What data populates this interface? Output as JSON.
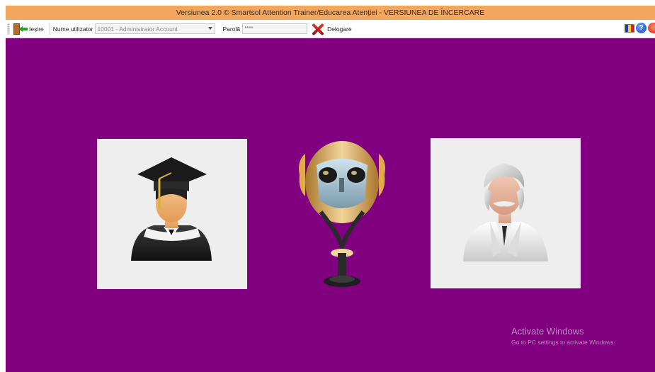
{
  "window": {
    "title": "Versiunea 2.0 © Smartsol Attention Trainer/Educarea Atenției - VERSIUNEA DE ÎNCERCARE"
  },
  "toolbar": {
    "exit_label": "Ieșire",
    "username_label": "Nume utilizator",
    "username_value": "10001 - Administrator Account",
    "password_label": "Parolă",
    "password_value": "****",
    "logout_label": "Delogare",
    "flag_colors": [
      "#1b3fa8",
      "#f6d11b",
      "#d11e2a"
    ],
    "help_glyph": "?"
  },
  "main": {
    "background": "#800080",
    "cards": [
      {
        "name": "student",
        "icon": "graduate-icon"
      },
      {
        "name": "viewer",
        "icon": "binocular-viewer-icon"
      },
      {
        "name": "doctor",
        "icon": "doctor-icon"
      }
    ]
  },
  "watermark": {
    "line1": "Activate Windows",
    "line2": "Go to PC settings to activate Windows."
  }
}
